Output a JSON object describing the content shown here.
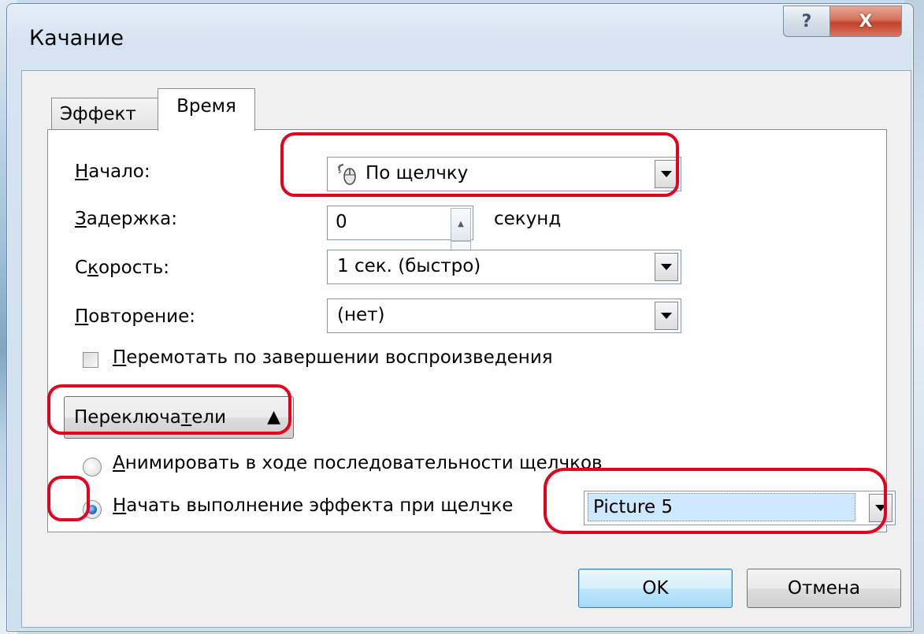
{
  "window": {
    "title": "Качание",
    "help_label": "?",
    "close_label": "X"
  },
  "tabs": [
    {
      "label": "Эффект",
      "active": false
    },
    {
      "label": "Время",
      "active": true
    }
  ],
  "timing": {
    "start": {
      "label_accel": "Н",
      "label_rest": "ачало:",
      "value": "По щелчку"
    },
    "delay": {
      "label_accel": "З",
      "label_rest": "адержка:",
      "value": "0",
      "unit": "секунд"
    },
    "speed": {
      "label_pre": "С",
      "label_accel": "к",
      "label_rest": "орость:",
      "value": "1 сек. (быстро)"
    },
    "repeat": {
      "label_accel": "П",
      "label_rest": "овторение:",
      "value": "(нет)"
    },
    "rewind": {
      "label_pre": "",
      "label_accel": "П",
      "label_rest": "еремотать по завершении воспроизведения",
      "checked": false
    }
  },
  "triggers": {
    "button_pre": "Переключа",
    "button_accel": "т",
    "button_rest": "ели",
    "chevron": "⯭",
    "animate_sequence": {
      "accel": "А",
      "rest": "нимировать в ходе последовательности щелчков",
      "checked": false
    },
    "start_on_click": {
      "accel": "Н",
      "rest_pre": "ачать выполнение эффекта при щел",
      "rest_accel": "ч",
      "rest_post": "ке",
      "checked": true
    },
    "object_value": "Picture 5"
  },
  "buttons": {
    "ok": "OK",
    "cancel": "Отмена"
  },
  "colors": {
    "highlight": "#e5001e",
    "selection": "#cde8ff"
  }
}
